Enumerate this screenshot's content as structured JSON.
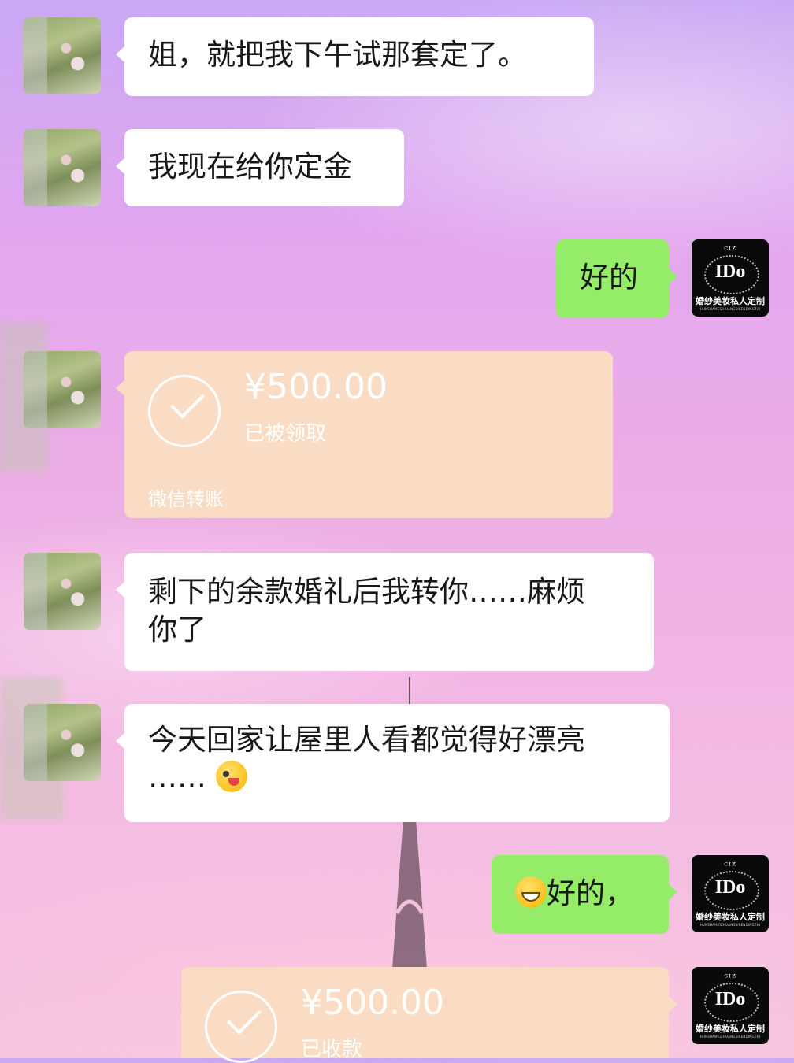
{
  "messages": [
    {
      "sender": "friend",
      "type": "text",
      "text": "姐，就把我下午试那套定了。"
    },
    {
      "sender": "friend",
      "type": "text",
      "text": "我现在给你定金"
    },
    {
      "sender": "self",
      "type": "text",
      "text": "好的"
    },
    {
      "sender": "friend",
      "type": "transfer",
      "amount": "¥500.00",
      "status": "已被领取",
      "source": "微信转账"
    },
    {
      "sender": "friend",
      "type": "text",
      "line1": "剩下的余款婚礼后我转你……麻烦",
      "line2": "你了"
    },
    {
      "sender": "friend",
      "type": "text",
      "line1": "今天回家让屋里人看都觉得好漂亮",
      "line2": "……",
      "emoji": "wink-tongue-emoji"
    },
    {
      "sender": "self",
      "type": "text",
      "emoji": "grin-emoji",
      "text": "好的，"
    },
    {
      "sender": "self",
      "type": "transfer",
      "amount": "¥500.00",
      "status": "已收款"
    }
  ],
  "self_avatar": {
    "crown": "ᶜᶦᶻ",
    "mark": "IDo",
    "subtitle": "婚纱美妆私人定制",
    "tiny": "HUNSHAMEIZHUANGSIRENDINGZHI"
  },
  "colors": {
    "incoming_bubble": "#ffffff",
    "outgoing_bubble": "#95ec69",
    "transfer_bubble": "#f9dcc3"
  }
}
